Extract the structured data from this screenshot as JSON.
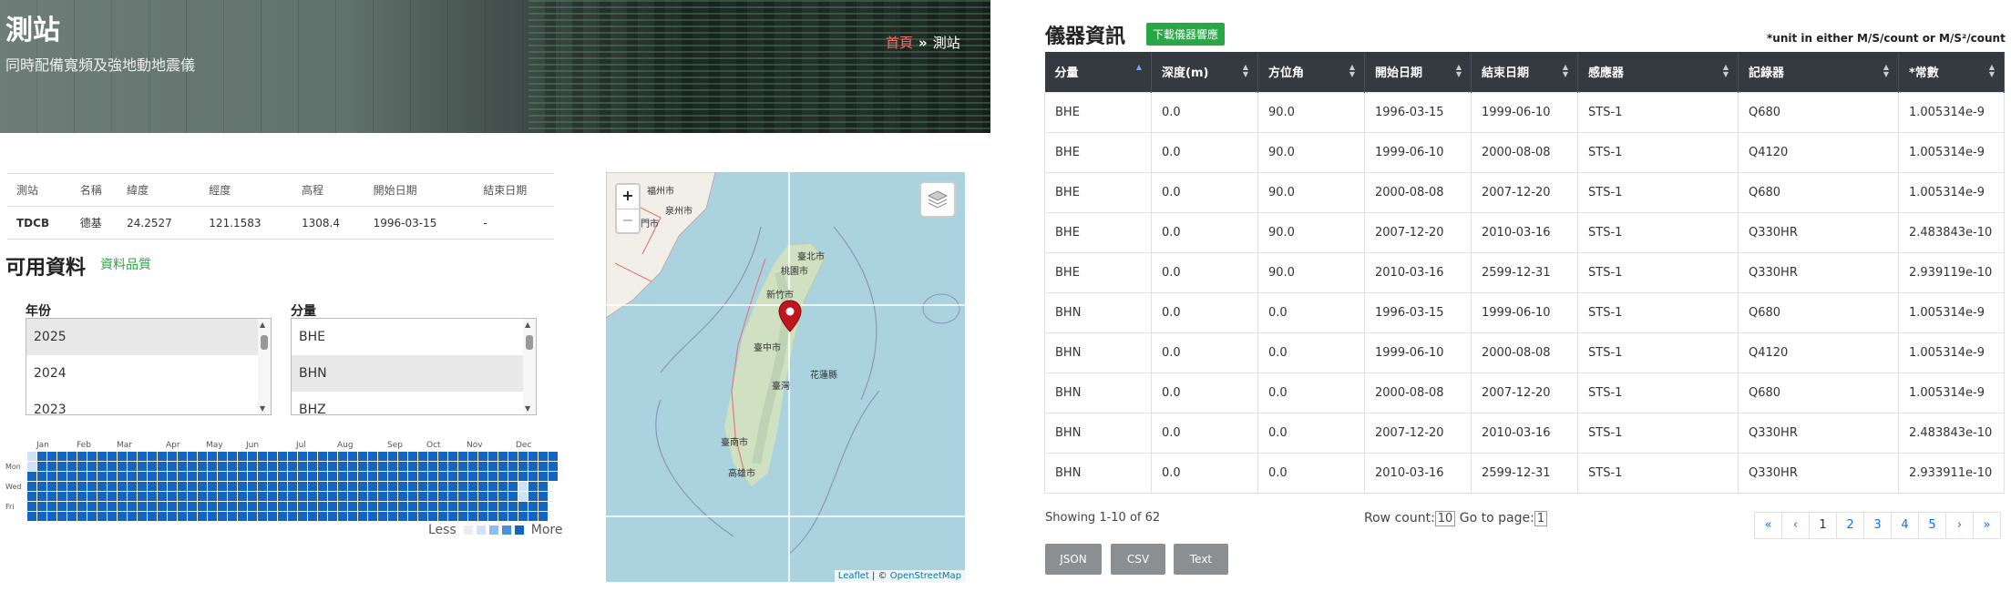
{
  "banner": {
    "title": "測站",
    "subtitle": "同時配備寬頻及強地動地震儀"
  },
  "breadcrumb": {
    "home": "首頁",
    "separator": "»",
    "current": "測站"
  },
  "station_table": {
    "headers": [
      "測站",
      "名稱",
      "緯度",
      "經度",
      "高程",
      "開始日期",
      "結束日期"
    ],
    "row": [
      "TDCB",
      "德基",
      "24.2527",
      "121.1583",
      "1308.4",
      "1996-03-15",
      "-"
    ]
  },
  "available": {
    "title": "可用資料",
    "quality_link": "資料品質"
  },
  "year_select": {
    "label": "年份",
    "options": [
      "2025",
      "2024",
      "2023"
    ],
    "selected": "2025"
  },
  "component_select": {
    "label": "分量",
    "options": [
      "BHE",
      "BHN",
      "BHZ"
    ],
    "selected": "BHE"
  },
  "heatmap": {
    "months": [
      "Jan",
      "Feb",
      "Mar",
      "Apr",
      "May",
      "Jun",
      "Jul",
      "Aug",
      "Sep",
      "Oct",
      "Nov",
      "Dec"
    ],
    "days": [
      "Mon",
      "Wed",
      "Fri"
    ],
    "legend_less": "Less",
    "legend_more": "More",
    "colors": [
      "#e9eef5",
      "#cfe2f8",
      "#90bdf0",
      "#4a90e2",
      "#1565c0"
    ]
  },
  "map": {
    "zoom_in": "+",
    "zoom_out": "−",
    "attribution_leaflet": "Leaflet",
    "attribution_sep": "| ©",
    "attribution_osm": "OpenStreetMap",
    "labels": [
      "臺北市",
      "桃園市",
      "新竹市",
      "臺中市",
      "花蓮縣",
      "臺灣",
      "臺南市",
      "高雄市",
      "福州市",
      "廈門市",
      "泉州市"
    ]
  },
  "instrument": {
    "title": "儀器資訊",
    "download_button": "下載儀器響應",
    "unit_note": "*unit in either M/S/count or M/S²/count",
    "headers": [
      "分量",
      "深度(m)",
      "方位角",
      "開始日期",
      "結束日期",
      "感應器",
      "記錄器",
      "*常數"
    ],
    "rows": [
      [
        "BHE",
        "0.0",
        "90.0",
        "1996-03-15",
        "1999-06-10",
        "STS-1",
        "Q680",
        "1.005314e-9"
      ],
      [
        "BHE",
        "0.0",
        "90.0",
        "1999-06-10",
        "2000-08-08",
        "STS-1",
        "Q4120",
        "1.005314e-9"
      ],
      [
        "BHE",
        "0.0",
        "90.0",
        "2000-08-08",
        "2007-12-20",
        "STS-1",
        "Q680",
        "1.005314e-9"
      ],
      [
        "BHE",
        "0.0",
        "90.0",
        "2007-12-20",
        "2010-03-16",
        "STS-1",
        "Q330HR",
        "2.483843e-10"
      ],
      [
        "BHE",
        "0.0",
        "90.0",
        "2010-03-16",
        "2599-12-31",
        "STS-1",
        "Q330HR",
        "2.939119e-10"
      ],
      [
        "BHN",
        "0.0",
        "0.0",
        "1996-03-15",
        "1999-06-10",
        "STS-1",
        "Q680",
        "1.005314e-9"
      ],
      [
        "BHN",
        "0.0",
        "0.0",
        "1999-06-10",
        "2000-08-08",
        "STS-1",
        "Q4120",
        "1.005314e-9"
      ],
      [
        "BHN",
        "0.0",
        "0.0",
        "2000-08-08",
        "2007-12-20",
        "STS-1",
        "Q680",
        "1.005314e-9"
      ],
      [
        "BHN",
        "0.0",
        "0.0",
        "2007-12-20",
        "2010-03-16",
        "STS-1",
        "Q330HR",
        "2.483843e-10"
      ],
      [
        "BHN",
        "0.0",
        "0.0",
        "2010-03-16",
        "2599-12-31",
        "STS-1",
        "Q330HR",
        "2.933911e-10"
      ]
    ],
    "showing": "Showing 1-10 of 62",
    "row_count_label": "Row count:",
    "row_count_value": "10",
    "goto_label": "Go to page:",
    "goto_value": "1",
    "pages": [
      "«",
      "‹",
      "1",
      "2",
      "3",
      "4",
      "5",
      "›",
      "»"
    ],
    "exports": [
      "JSON",
      "CSV",
      "Text"
    ]
  }
}
